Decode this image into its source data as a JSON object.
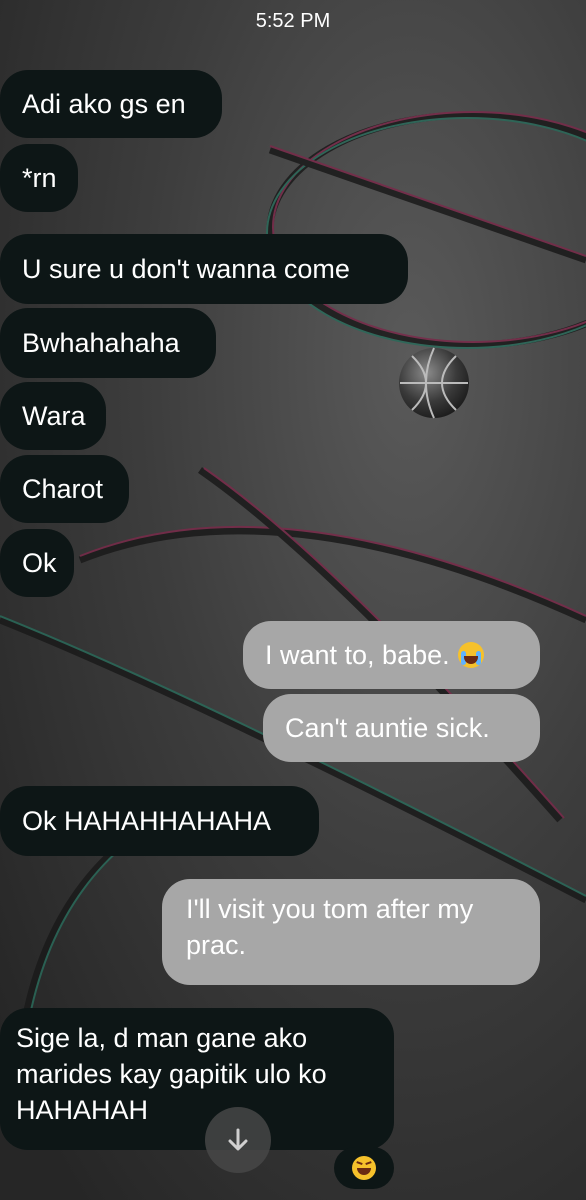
{
  "status_bar": {
    "time": "5:52 PM"
  },
  "messages": [
    {
      "text": "Adi ako gs en",
      "direction": "incoming"
    },
    {
      "text": "*rn",
      "direction": "incoming"
    },
    {
      "text": "U sure u don't wanna come",
      "direction": "incoming"
    },
    {
      "text": "Bwhahahaha",
      "direction": "incoming"
    },
    {
      "text": "Wara",
      "direction": "incoming"
    },
    {
      "text": "Charot",
      "direction": "incoming"
    },
    {
      "text": "Ok",
      "direction": "incoming"
    },
    {
      "text": "I want to, babe.",
      "emoji": "loudly-crying-face",
      "direction": "outgoing"
    },
    {
      "text": "Can't auntie sick.",
      "direction": "outgoing"
    },
    {
      "text": "Ok HAHAHHAHAHA",
      "direction": "incoming"
    },
    {
      "text": "I'll visit you tom after my prac.",
      "direction": "outgoing"
    },
    {
      "text": "Sige la, d man gane ako marides kay gapitik ulo ko HAHAHAH",
      "direction": "incoming",
      "reaction": "grinning-squinting-face"
    }
  ],
  "colors": {
    "incoming_bubble": "#0d1616",
    "outgoing_bubble": "#a7a7a7",
    "text": "#ffffff"
  },
  "icons": {
    "scroll_down": "arrow-down-icon",
    "reaction": "grinning-squinting-face-icon",
    "wallpaper_ball": "basketball-icon"
  }
}
